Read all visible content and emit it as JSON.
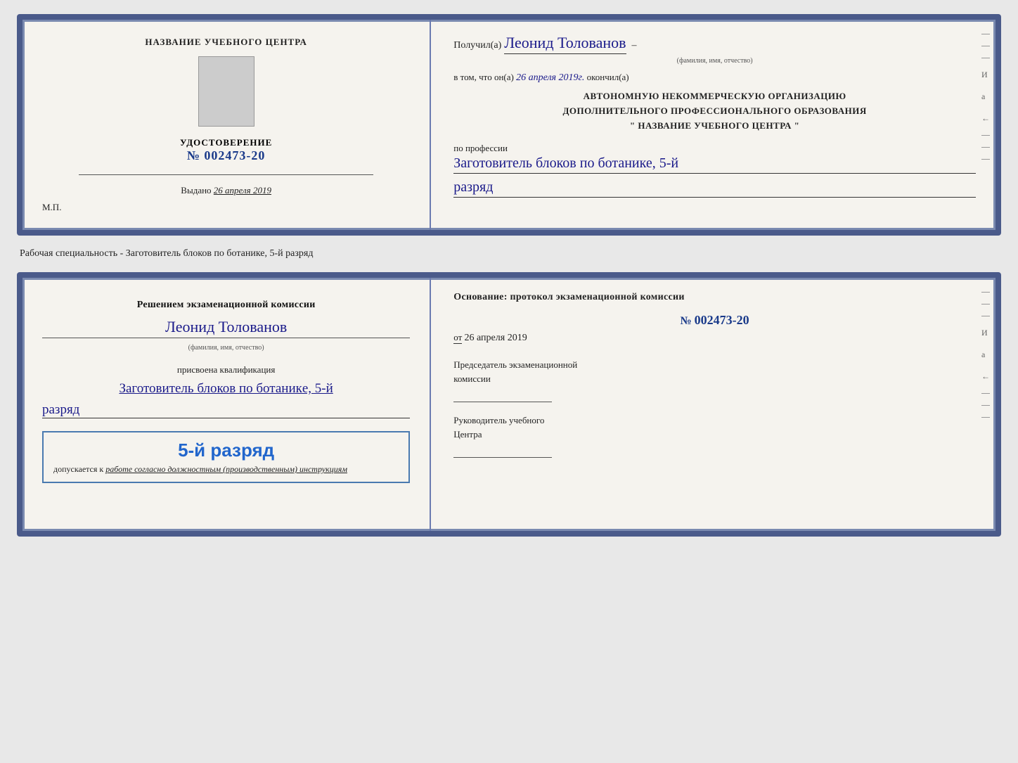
{
  "top_cert": {
    "left": {
      "center_title": "НАЗВАНИЕ УЧЕБНОГО ЦЕНТРА",
      "cert_label": "УДОСТОВЕРЕНИЕ",
      "cert_number_prefix": "№",
      "cert_number": "002473-20",
      "issued_label": "Выдано",
      "issued_date": "26 апреля 2019",
      "mp_label": "М.П."
    },
    "right": {
      "received_label": "Получил(а)",
      "recipient_name": "Леонид Толованов",
      "sub_label": "(фамилия, имя, отчество)",
      "confirm_text": "в том, что он(а)",
      "confirm_date": "26 апреля 2019г.",
      "confirm_end": "окончил(а)",
      "org_line1": "АВТОНОМНУЮ НЕКОММЕРЧЕСКУЮ ОРГАНИЗАЦИЮ",
      "org_line2": "ДОПОЛНИТЕЛЬНОГО ПРОФЕССИОНАЛЬНОГО ОБРАЗОВАНИЯ",
      "org_line3": "\"  НАЗВАНИЕ УЧЕБНОГО ЦЕНТРА  \"",
      "profession_label": "по профессии",
      "profession_name": "Заготовитель блоков по ботанике, 5-й",
      "rank": "разряд"
    }
  },
  "spec_label": "Рабочая специальность - Заготовитель блоков по ботанике, 5-й разряд",
  "bottom_cert": {
    "left": {
      "decision_line1": "Решением экзаменационной комиссии",
      "person_name": "Леонид Толованов",
      "sub_label": "(фамилия, имя, отчество)",
      "qualification_label": "присвоена квалификация",
      "qualification_name": "Заготовитель блоков по ботаникe, 5-й",
      "rank": "разряд",
      "stamp_rank": "5-й разряд",
      "stamp_allowed": "допускается к",
      "stamp_italic": "работе согласно должностным (производственным) инструкциям"
    },
    "right": {
      "basis_title": "Основание: протокол экзаменационной комиссии",
      "protocol_prefix": "№",
      "protocol_number": "002473-20",
      "from_label": "от",
      "from_date": "26 апреля 2019",
      "chairman_line1": "Председатель экзаменационной",
      "chairman_line2": "комиссии",
      "head_line1": "Руководитель учебного",
      "head_line2": "Центра"
    }
  },
  "side_marks": {
    "letters": [
      "И",
      "а",
      "←",
      "–",
      "–",
      "–",
      "–",
      "–"
    ]
  }
}
